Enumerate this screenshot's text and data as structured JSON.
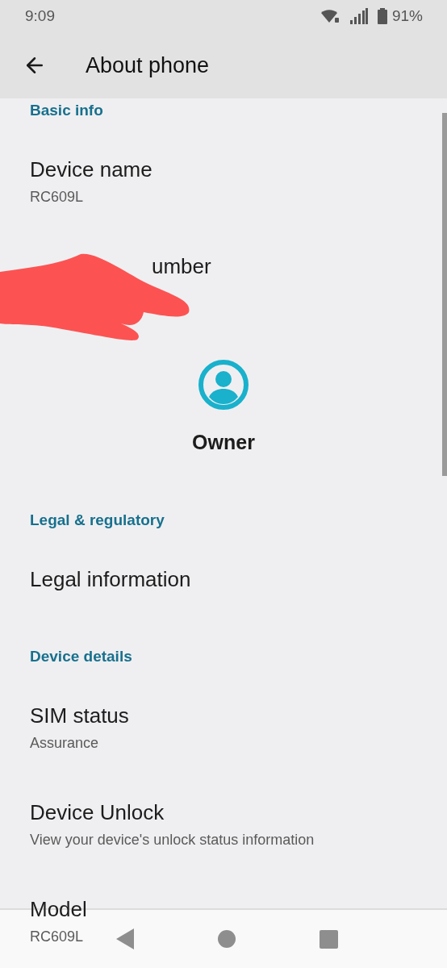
{
  "status_bar": {
    "time": "9:09",
    "battery": "91%"
  },
  "app_bar": {
    "title": "About phone"
  },
  "sections": [
    {
      "header": "Basic info",
      "items": [
        {
          "kind": "entry",
          "title": "Device name",
          "summary": "RC609L"
        },
        {
          "kind": "redacted",
          "title": "umber"
        },
        {
          "kind": "profile",
          "title": "Owner"
        }
      ]
    },
    {
      "header": "Legal & regulatory",
      "items": [
        {
          "kind": "entry",
          "title": "Legal information"
        }
      ]
    },
    {
      "header": "Device details",
      "items": [
        {
          "kind": "entry",
          "title": "SIM status",
          "summary": "Assurance"
        },
        {
          "kind": "entry",
          "title": "Device Unlock",
          "summary": "View your device's unlock status information"
        },
        {
          "kind": "entry",
          "title": "Model",
          "summary": "RC609L"
        }
      ]
    }
  ]
}
